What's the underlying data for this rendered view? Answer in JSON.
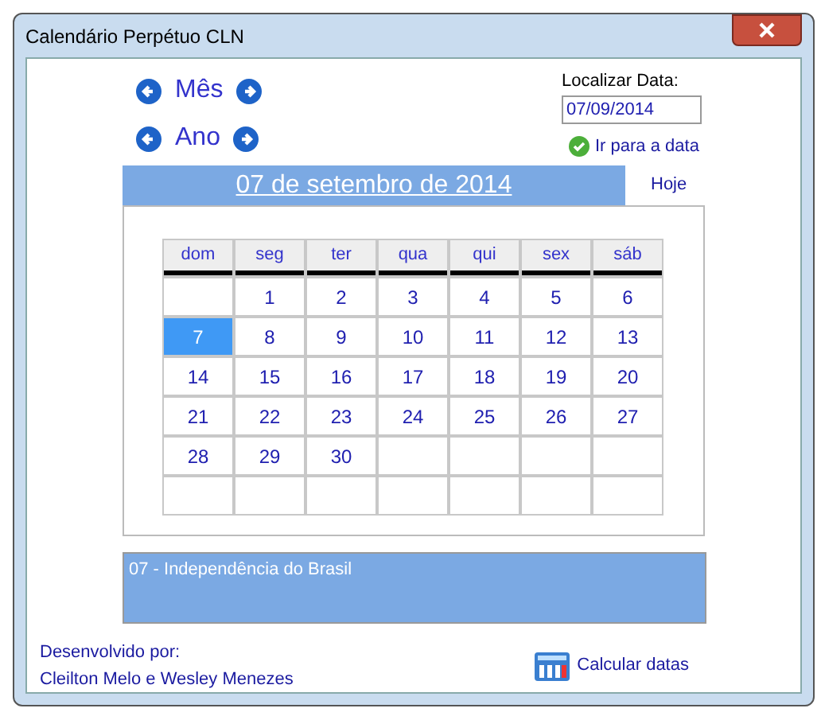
{
  "window": {
    "title": "Calendário Perpétuo CLN"
  },
  "navigation": [
    {
      "label": "Mês"
    },
    {
      "label": "Ano"
    }
  ],
  "find_date": {
    "label": "Localizar Data:",
    "value": "07/09/2014",
    "go_link": "Ir para a data"
  },
  "header": {
    "title": "07 de setembro de 2014",
    "today_link": "Hoje"
  },
  "calendar": {
    "columns": [
      "dom",
      "seg",
      "ter",
      "qua",
      "qui",
      "sex",
      "sáb"
    ],
    "rows": [
      [
        {
          "kind": "blank"
        },
        {
          "kind": "day",
          "day": "1",
          "selected": false
        },
        {
          "kind": "day",
          "day": "2",
          "selected": false
        },
        {
          "kind": "day",
          "day": "3",
          "selected": false
        },
        {
          "kind": "day",
          "day": "4",
          "selected": false
        },
        {
          "kind": "day",
          "day": "5",
          "selected": false
        },
        {
          "kind": "day",
          "day": "6",
          "selected": false
        }
      ],
      [
        {
          "kind": "day",
          "day": "7",
          "selected": true
        },
        {
          "kind": "day",
          "day": "8",
          "selected": false
        },
        {
          "kind": "day",
          "day": "9",
          "selected": false
        },
        {
          "kind": "day",
          "day": "10",
          "selected": false
        },
        {
          "kind": "day",
          "day": "11",
          "selected": false
        },
        {
          "kind": "day",
          "day": "12",
          "selected": false
        },
        {
          "kind": "day",
          "day": "13",
          "selected": false
        }
      ],
      [
        {
          "kind": "day",
          "day": "14",
          "selected": false
        },
        {
          "kind": "day",
          "day": "15",
          "selected": false
        },
        {
          "kind": "day",
          "day": "16",
          "selected": false
        },
        {
          "kind": "day",
          "day": "17",
          "selected": false
        },
        {
          "kind": "day",
          "day": "18",
          "selected": false
        },
        {
          "kind": "day",
          "day": "19",
          "selected": false
        },
        {
          "kind": "day",
          "day": "20",
          "selected": false
        }
      ],
      [
        {
          "kind": "day",
          "day": "21",
          "selected": false
        },
        {
          "kind": "day",
          "day": "22",
          "selected": false
        },
        {
          "kind": "day",
          "day": "23",
          "selected": false
        },
        {
          "kind": "day",
          "day": "24",
          "selected": false
        },
        {
          "kind": "day",
          "day": "25",
          "selected": false
        },
        {
          "kind": "day",
          "day": "26",
          "selected": false
        },
        {
          "kind": "day",
          "day": "27",
          "selected": false
        }
      ],
      [
        {
          "kind": "day",
          "day": "28",
          "selected": false
        },
        {
          "kind": "day",
          "day": "29",
          "selected": false
        },
        {
          "kind": "day",
          "day": "30",
          "selected": false
        },
        {
          "kind": "blank"
        },
        {
          "kind": "blank"
        },
        {
          "kind": "blank"
        },
        {
          "kind": "blank"
        }
      ],
      [
        {
          "kind": "blank"
        },
        {
          "kind": "blank"
        },
        {
          "kind": "blank"
        },
        {
          "kind": "blank"
        },
        {
          "kind": "blank"
        },
        {
          "kind": "blank"
        },
        {
          "kind": "blank"
        }
      ]
    ]
  },
  "events": [
    "07 - Independência do Brasil"
  ],
  "footer": {
    "credit_label": "Desenvolvido por:",
    "credit_names": "Cleilton Melo e Wesley Menezes",
    "calculate_link": "Calcular datas"
  }
}
